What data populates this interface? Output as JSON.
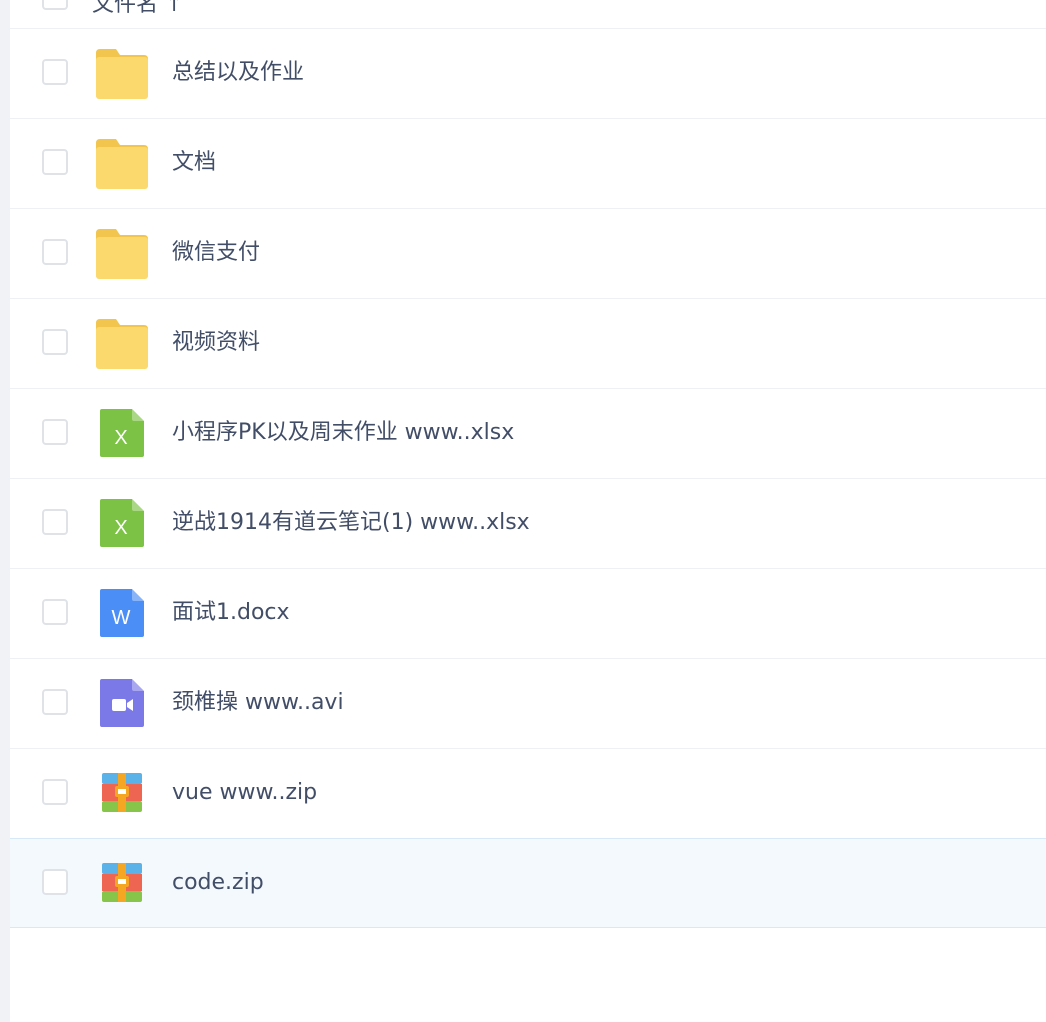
{
  "list": {
    "header_label": "文件名 ↑",
    "rows": [
      {
        "name": "总结以及作业",
        "icon": "folder-icon",
        "type": "folder"
      },
      {
        "name": "文档",
        "icon": "folder-icon",
        "type": "folder"
      },
      {
        "name": "微信支付",
        "icon": "folder-icon",
        "type": "folder"
      },
      {
        "name": "视频资料",
        "icon": "folder-icon",
        "type": "folder"
      },
      {
        "name": "小程序PK以及周末作业 www..xlsx",
        "icon": "excel-file-icon",
        "type": "xlsx",
        "glyph": "X"
      },
      {
        "name": "逆战1914有道云笔记(1) www..xlsx",
        "icon": "excel-file-icon",
        "type": "xlsx",
        "glyph": "X"
      },
      {
        "name": "面试1.docx",
        "icon": "word-file-icon",
        "type": "docx",
        "glyph": "W"
      },
      {
        "name": "颈椎操 www..avi",
        "icon": "video-file-icon",
        "type": "avi"
      },
      {
        "name": "vue www..zip",
        "icon": "zip-archive-icon",
        "type": "zip"
      },
      {
        "name": "code.zip",
        "icon": "zip-archive-icon",
        "type": "zip",
        "selected": true
      }
    ]
  },
  "colors": {
    "folder": "#fbd96c",
    "folder_tab": "#f2c54e",
    "excel": "#7cc244",
    "word": "#4b8ef5",
    "video": "#7b78e8",
    "zip_red": "#ee6552",
    "zip_blue": "#5bb2e8",
    "zip_green": "#86c549",
    "zip_orange": "#f5a623",
    "text": "#424e67",
    "selected_row": "#f4f9fe"
  }
}
